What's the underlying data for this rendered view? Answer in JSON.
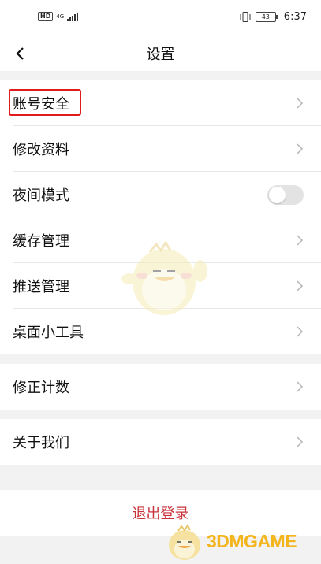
{
  "status_bar": {
    "hd": "HD",
    "network": "4G",
    "battery": "43",
    "time": "6:37"
  },
  "header": {
    "title": "设置"
  },
  "settings": {
    "group1": [
      {
        "label": "账号安全",
        "type": "link"
      },
      {
        "label": "修改资料",
        "type": "link"
      },
      {
        "label": "夜间模式",
        "type": "toggle",
        "on": false
      },
      {
        "label": "缓存管理",
        "type": "link"
      },
      {
        "label": "推送管理",
        "type": "link"
      },
      {
        "label": "桌面小工具",
        "type": "link"
      }
    ],
    "group2": [
      {
        "label": "修正计数",
        "type": "link"
      }
    ],
    "group3": [
      {
        "label": "关于我们",
        "type": "link"
      }
    ]
  },
  "logout": {
    "label": "退出登录"
  },
  "watermark": {
    "text": "3DMGAME"
  },
  "colors": {
    "highlight": "#e01b1b",
    "logout": "#c8323a",
    "watermark": "#f3b51b"
  },
  "icons": {
    "back": "chevron-left-icon",
    "row": "chevron-right-icon"
  }
}
